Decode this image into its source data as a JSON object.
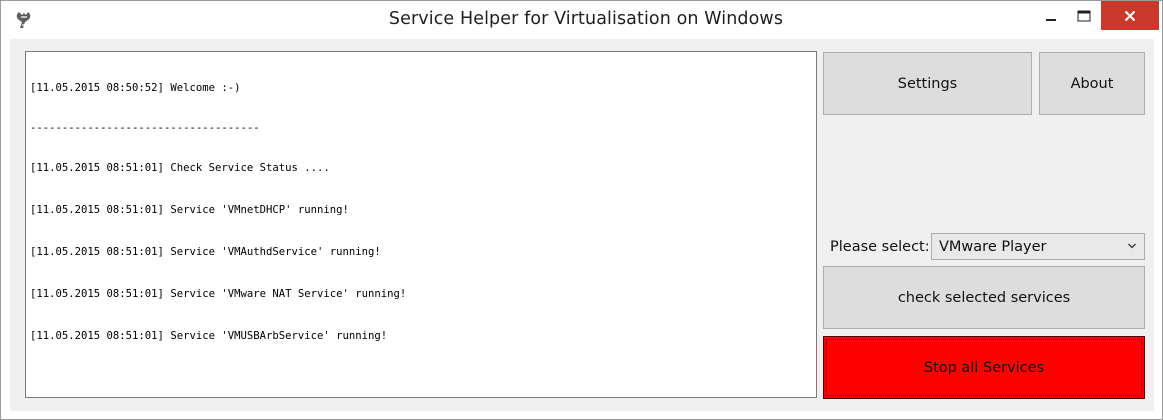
{
  "window": {
    "title": "Service Helper for Virtualisation on Windows",
    "icons": {
      "app": "app-icon",
      "minimize": "minimize-icon",
      "maximize": "maximize-icon",
      "close": "close-icon"
    },
    "colors": {
      "close_button": "#c9392b",
      "client_bg": "#f0f0f0"
    }
  },
  "log": {
    "lines": [
      "[11.05.2015 08:50:52] Welcome :-)",
      "------------------------------------",
      "[11.05.2015 08:51:01] Check Service Status ....",
      "[11.05.2015 08:51:01] Service 'VMnetDHCP' running!",
      "[11.05.2015 08:51:01] Service 'VMAuthdService' running!",
      "[11.05.2015 08:51:01] Service 'VMware NAT Service' running!",
      "[11.05.2015 08:51:01] Service 'VMUSBArbService' running!"
    ]
  },
  "buttons": {
    "settings": "Settings",
    "about": "About",
    "check": "check selected services",
    "stop": "Stop all Services",
    "stop_color": "#ff0000"
  },
  "selector": {
    "label": "Please select:",
    "value": "VMware Player",
    "icon": "chevron-down-icon"
  }
}
